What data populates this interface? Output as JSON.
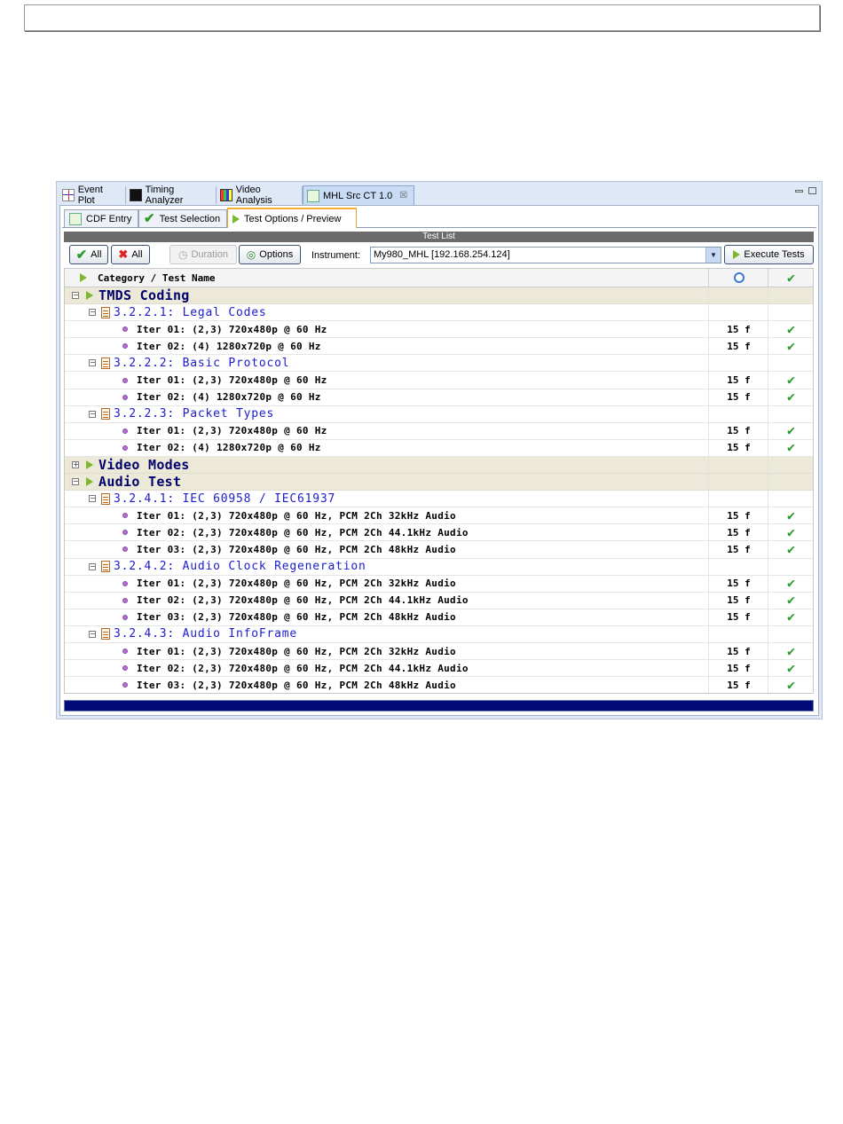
{
  "view_tabs": [
    {
      "label": "Event Plot",
      "icon": "event-plot-icon"
    },
    {
      "label": "Timing Analyzer",
      "icon": "timing-analyzer-icon"
    },
    {
      "label": "Video Analysis",
      "icon": "video-analysis-icon"
    },
    {
      "label": "MHL Src CT 1.0",
      "icon": "mhl-test-icon",
      "active": true,
      "closable": true
    }
  ],
  "sub_tabs": [
    {
      "label": "CDF Entry",
      "icon": "cdf-entry-icon"
    },
    {
      "label": "Test Selection",
      "icon": "checkmark-icon"
    },
    {
      "label": "Test Options / Preview",
      "icon": "play-icon",
      "active": true
    }
  ],
  "test_list_title": "Test List",
  "toolbar": {
    "select_all_label": "All",
    "deselect_all_label": "All",
    "duration_label": "Duration",
    "options_label": "Options",
    "instrument_label": "Instrument:",
    "instrument_value": "My980_MHL [192.168.254.124]",
    "execute_label": "Execute Tests"
  },
  "table": {
    "header_name": "Category / Test Name",
    "header_duration_icon": "clock-icon",
    "header_pass_icon": "checkmark-icon",
    "categories": [
      {
        "name": "TMDS Coding",
        "expanded": true,
        "groups": [
          {
            "name": "3.2.2.1: Legal Codes",
            "items": [
              {
                "name": "Iter 01: (2,3) 720x480p @ 60 Hz",
                "duration": "15 f",
                "passed": true
              },
              {
                "name": "Iter 02: (4) 1280x720p @ 60 Hz",
                "duration": "15 f",
                "passed": true
              }
            ]
          },
          {
            "name": "3.2.2.2: Basic Protocol",
            "items": [
              {
                "name": "Iter 01: (2,3) 720x480p @ 60 Hz",
                "duration": "15 f",
                "passed": true
              },
              {
                "name": "Iter 02: (4) 1280x720p @ 60 Hz",
                "duration": "15 f",
                "passed": true
              }
            ]
          },
          {
            "name": "3.2.2.3: Packet Types",
            "items": [
              {
                "name": "Iter 01: (2,3) 720x480p @ 60 Hz",
                "duration": "15 f",
                "passed": true
              },
              {
                "name": "Iter 02: (4) 1280x720p @ 60 Hz",
                "duration": "15 f",
                "passed": true
              }
            ]
          }
        ]
      },
      {
        "name": "Video Modes",
        "expanded": false,
        "groups": []
      },
      {
        "name": "Audio Test",
        "expanded": true,
        "groups": [
          {
            "name": "3.2.4.1: IEC 60958 / IEC61937",
            "items": [
              {
                "name": "Iter 01: (2,3) 720x480p @ 60 Hz, PCM 2Ch 32kHz Audio",
                "duration": "15 f",
                "passed": true
              },
              {
                "name": "Iter 02: (2,3) 720x480p @ 60 Hz, PCM 2Ch 44.1kHz Audio",
                "duration": "15 f",
                "passed": true
              },
              {
                "name": "Iter 03: (2,3) 720x480p @ 60 Hz, PCM 2Ch 48kHz Audio",
                "duration": "15 f",
                "passed": true
              }
            ]
          },
          {
            "name": "3.2.4.2: Audio Clock Regeneration",
            "items": [
              {
                "name": "Iter 01: (2,3) 720x480p @ 60 Hz, PCM 2Ch 32kHz Audio",
                "duration": "15 f",
                "passed": true
              },
              {
                "name": "Iter 02: (2,3) 720x480p @ 60 Hz, PCM 2Ch 44.1kHz Audio",
                "duration": "15 f",
                "passed": true
              },
              {
                "name": "Iter 03: (2,3) 720x480p @ 60 Hz, PCM 2Ch 48kHz Audio",
                "duration": "15 f",
                "passed": true
              }
            ]
          },
          {
            "name": "3.2.4.3: Audio InfoFrame",
            "items": [
              {
                "name": "Iter 01: (2,3) 720x480p @ 60 Hz, PCM 2Ch 32kHz Audio",
                "duration": "15 f",
                "passed": true
              },
              {
                "name": "Iter 02: (2,3) 720x480p @ 60 Hz, PCM 2Ch 44.1kHz Audio",
                "duration": "15 f",
                "passed": true
              },
              {
                "name": "Iter 03: (2,3) 720x480p @ 60 Hz, PCM 2Ch 48kHz Audio",
                "duration": "15 f",
                "passed": true
              }
            ]
          }
        ]
      }
    ]
  },
  "colors": {
    "category_text": "#00006e",
    "group_text": "#1c1ccc",
    "pass_check": "#2e9a2e",
    "status_bar": "#000a78"
  }
}
